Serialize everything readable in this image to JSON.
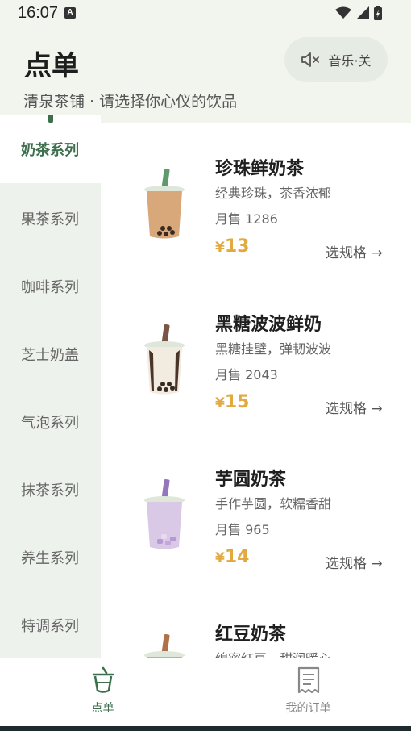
{
  "status": {
    "time": "16:07",
    "a_icon": "A"
  },
  "header": {
    "title": "点单",
    "subtitle": "清泉茶铺 · 请选择你心仪的饮品",
    "music_label": "音乐·关"
  },
  "sidebar": {
    "items": [
      {
        "label": "奶茶系列"
      },
      {
        "label": "果茶系列"
      },
      {
        "label": "咖啡系列"
      },
      {
        "label": "芝士奶盖"
      },
      {
        "label": "气泡系列"
      },
      {
        "label": "抹茶系列"
      },
      {
        "label": "养生系列"
      },
      {
        "label": "特调系列"
      }
    ]
  },
  "products": [
    {
      "name": "珍珠鲜奶茶",
      "desc": "经典珍珠，茶香浓郁",
      "sales": "月售 1286",
      "currency": "¥",
      "price": "13",
      "spec": "选规格 →",
      "cup_color": "#d8a87a",
      "straw_color": "#5f9a6b",
      "sales_count": 1286
    },
    {
      "name": "黑糖波波鲜奶",
      "desc": "黑糖挂壁，弹韧波波",
      "sales": "月售 2043",
      "currency": "¥",
      "price": "15",
      "spec": "选规格 →",
      "cup_color": "#f1ebe0",
      "straw_color": "#7a5545",
      "sales_count": 2043
    },
    {
      "name": "芋圆奶茶",
      "desc": "手作芋圆，软糯香甜",
      "sales": "月售 965",
      "currency": "¥",
      "price": "14",
      "spec": "选规格 →",
      "cup_color": "#d9c8e6",
      "straw_color": "#9576b8",
      "sales_count": 965
    },
    {
      "name": "红豆奶茶",
      "desc": "绵密红豆，甜润暖心",
      "sales": "",
      "currency": "",
      "price": "",
      "spec": "",
      "cup_color": "#d8a87a",
      "straw_color": "#b0704a"
    }
  ],
  "tabs": [
    {
      "label": "点单",
      "icon": "cup-icon",
      "color": "#3d6f4c"
    },
    {
      "label": "我的订单",
      "icon": "receipt-icon",
      "color": "#888888"
    }
  ],
  "colors": {
    "accent": "#3d6f4c",
    "price": "#e2a93f",
    "header_bg": "#f1f5ee",
    "sidebar_bg": "#eef2ec"
  }
}
